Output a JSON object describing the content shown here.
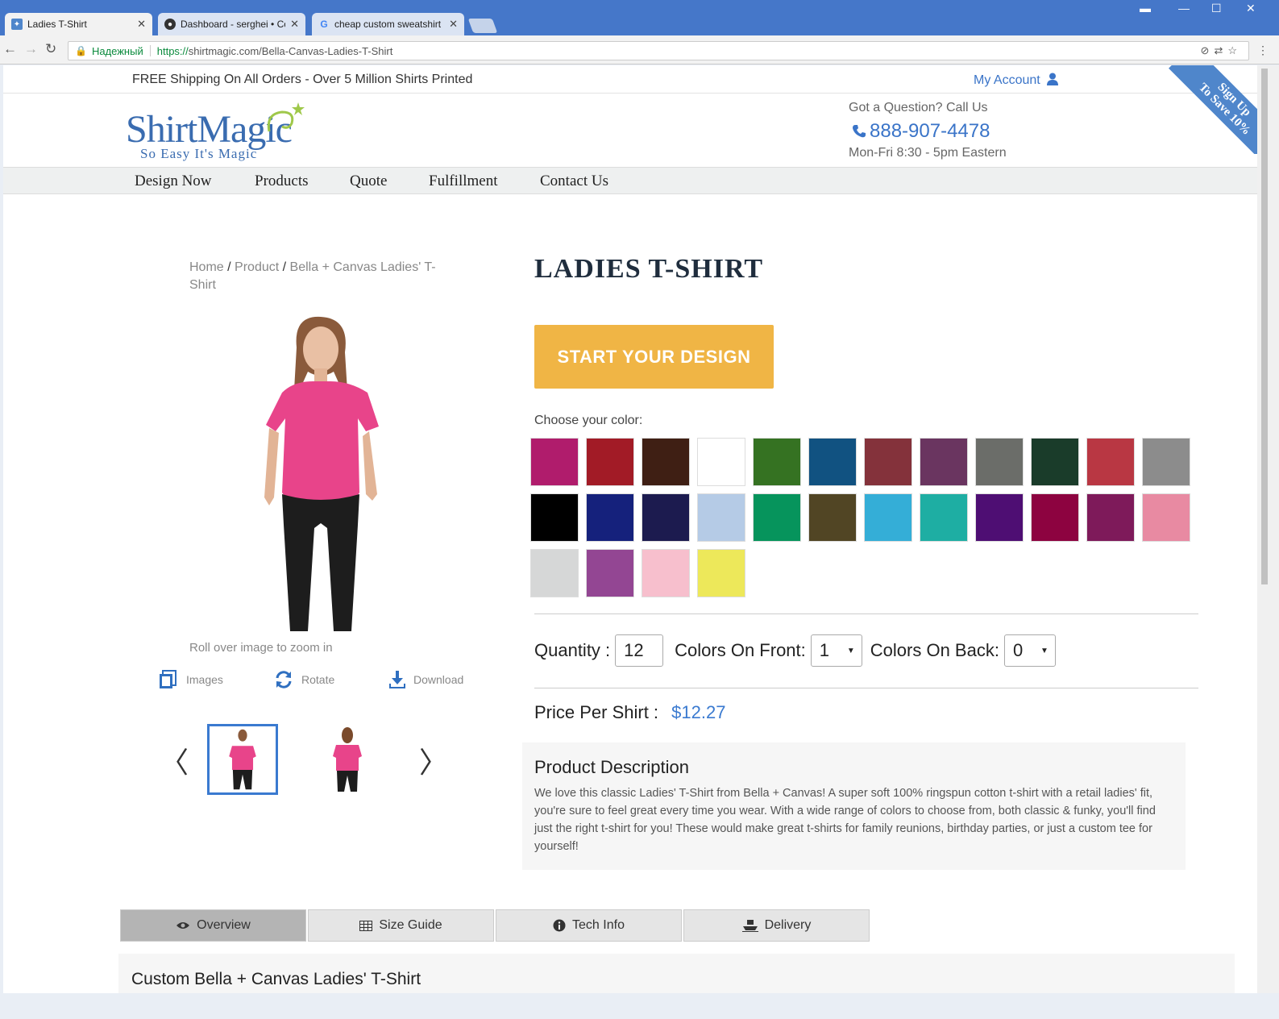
{
  "browser": {
    "tabs": [
      {
        "label": "Ladies T-Shirt",
        "active": true
      },
      {
        "label": "Dashboard - serghei • Co",
        "active": false
      },
      {
        "label": "cheap custom sweatshirt",
        "active": false
      }
    ],
    "url": {
      "secure_label": "Надежный",
      "scheme": "https://",
      "host_path": "shirtmagic.com/Bella-Canvas-Ladies-T-Shirt"
    }
  },
  "topbar": {
    "shipping": "FREE Shipping On All Orders - Over 5 Million Shirts Printed",
    "account": "My Account",
    "ribbon_line1": "Sign Up",
    "ribbon_line2": "To Save 10%"
  },
  "header": {
    "logo_main": "ShirtMagic",
    "logo_tagline": "So Easy It's Magic",
    "question": "Got a Question? Call Us",
    "phone": "888-907-4478",
    "hours": "Mon-Fri 8:30 - 5pm Eastern"
  },
  "nav": [
    "Design Now",
    "Products",
    "Quote",
    "Fulfillment",
    "Contact Us"
  ],
  "breadcrumb": {
    "home": "Home",
    "product": "Product",
    "current": "Bella + Canvas Ladies' T-Shirt"
  },
  "gallery": {
    "zoom_hint": "Roll over image to zoom in",
    "tools": [
      "Images",
      "Rotate",
      "Download"
    ],
    "prev": "〈",
    "next": "〉"
  },
  "product": {
    "title": "LADIES T-SHIRT",
    "cta": "START YOUR DESIGN",
    "choose_color": "Choose your color:",
    "colors": [
      "#b01c6c",
      "#a21b26",
      "#3f1f14",
      "#ffffff",
      "#357222",
      "#115281",
      "#84323b",
      "#6a3560",
      "#6b6d69",
      "#1a3c2a",
      "#b93743",
      "#8c8c8c",
      "#000000",
      "#15217c",
      "#1c1b4f",
      "#b5cbe6",
      "#06945c",
      "#514524",
      "#34aed7",
      "#1eaea3",
      "#4e0e73",
      "#8d0340",
      "#7e1a5a",
      "#e88aa2",
      "#d6d7d7",
      "#934693",
      "#f7bfcd",
      "#ede85a"
    ],
    "quantity_label": "Quantity :",
    "quantity_value": "12",
    "front_label": "Colors On Front:",
    "front_value": "1",
    "back_label": "Colors On Back:",
    "back_value": "0",
    "price_label": "Price Per Shirt :",
    "price_value": "$12.27",
    "desc_title": "Product Description",
    "desc_text": "We love this classic Ladies' T-Shirt from Bella + Canvas!  A super soft 100% ringspun cotton t-shirt with a retail ladies' fit, you're sure to feel great every time you wear.  With a wide range of colors to choose from, both classic & funky, you'll find just the right t-shirt for you!  These would make great t-shirts for family reunions, birthday parties, or just a custom tee for yourself!"
  },
  "info_tabs": [
    "Overview",
    "Size Guide",
    "Tech Info",
    "Delivery"
  ],
  "overview_title": "Custom Bella + Canvas Ladies' T-Shirt"
}
